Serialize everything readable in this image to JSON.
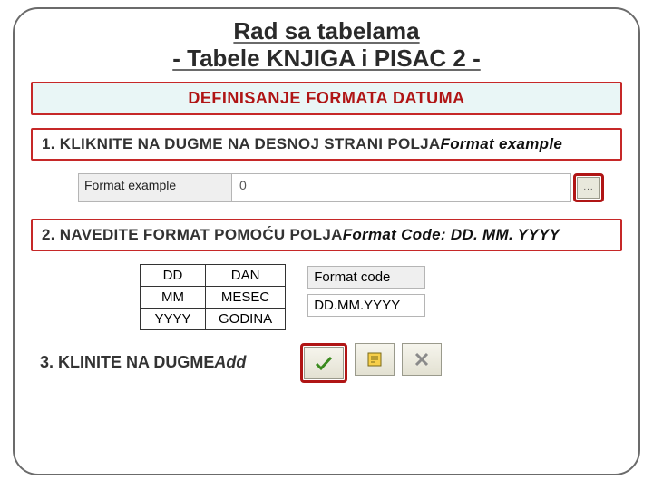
{
  "title_line1": "Rad sa tabelama",
  "title_line2": "- Tabele KNJIGA i PISAC 2 -",
  "section_header": "DEFINISANJE FORMATA DATUMA",
  "step1_prefix": "1. KLIKNITE NA DUGME NA DESNOJ STRANI POLJA",
  "step1_field": "Format example",
  "format_example_label": "Format example",
  "format_example_value": "0",
  "ellipsis_button_label": "...",
  "step2_prefix": "2. NAVEDITE FORMAT POMOĆU POLJA",
  "step2_field": "Format Code:",
  "step2_value": " DD. MM. YYYY",
  "fmt_table": {
    "rows": [
      {
        "code": "DD",
        "meaning": "DAN"
      },
      {
        "code": "MM",
        "meaning": "MESEC"
      },
      {
        "code": "YYYY",
        "meaning": "GODINA"
      }
    ]
  },
  "format_code_label": "Format code",
  "format_code_value": "DD.MM.YYYY",
  "step3_prefix": "3. KLINITE NA DUGME",
  "step3_button": "Add",
  "icons": {
    "confirm": "check-icon",
    "note": "note-icon",
    "cancel": "x-icon"
  }
}
